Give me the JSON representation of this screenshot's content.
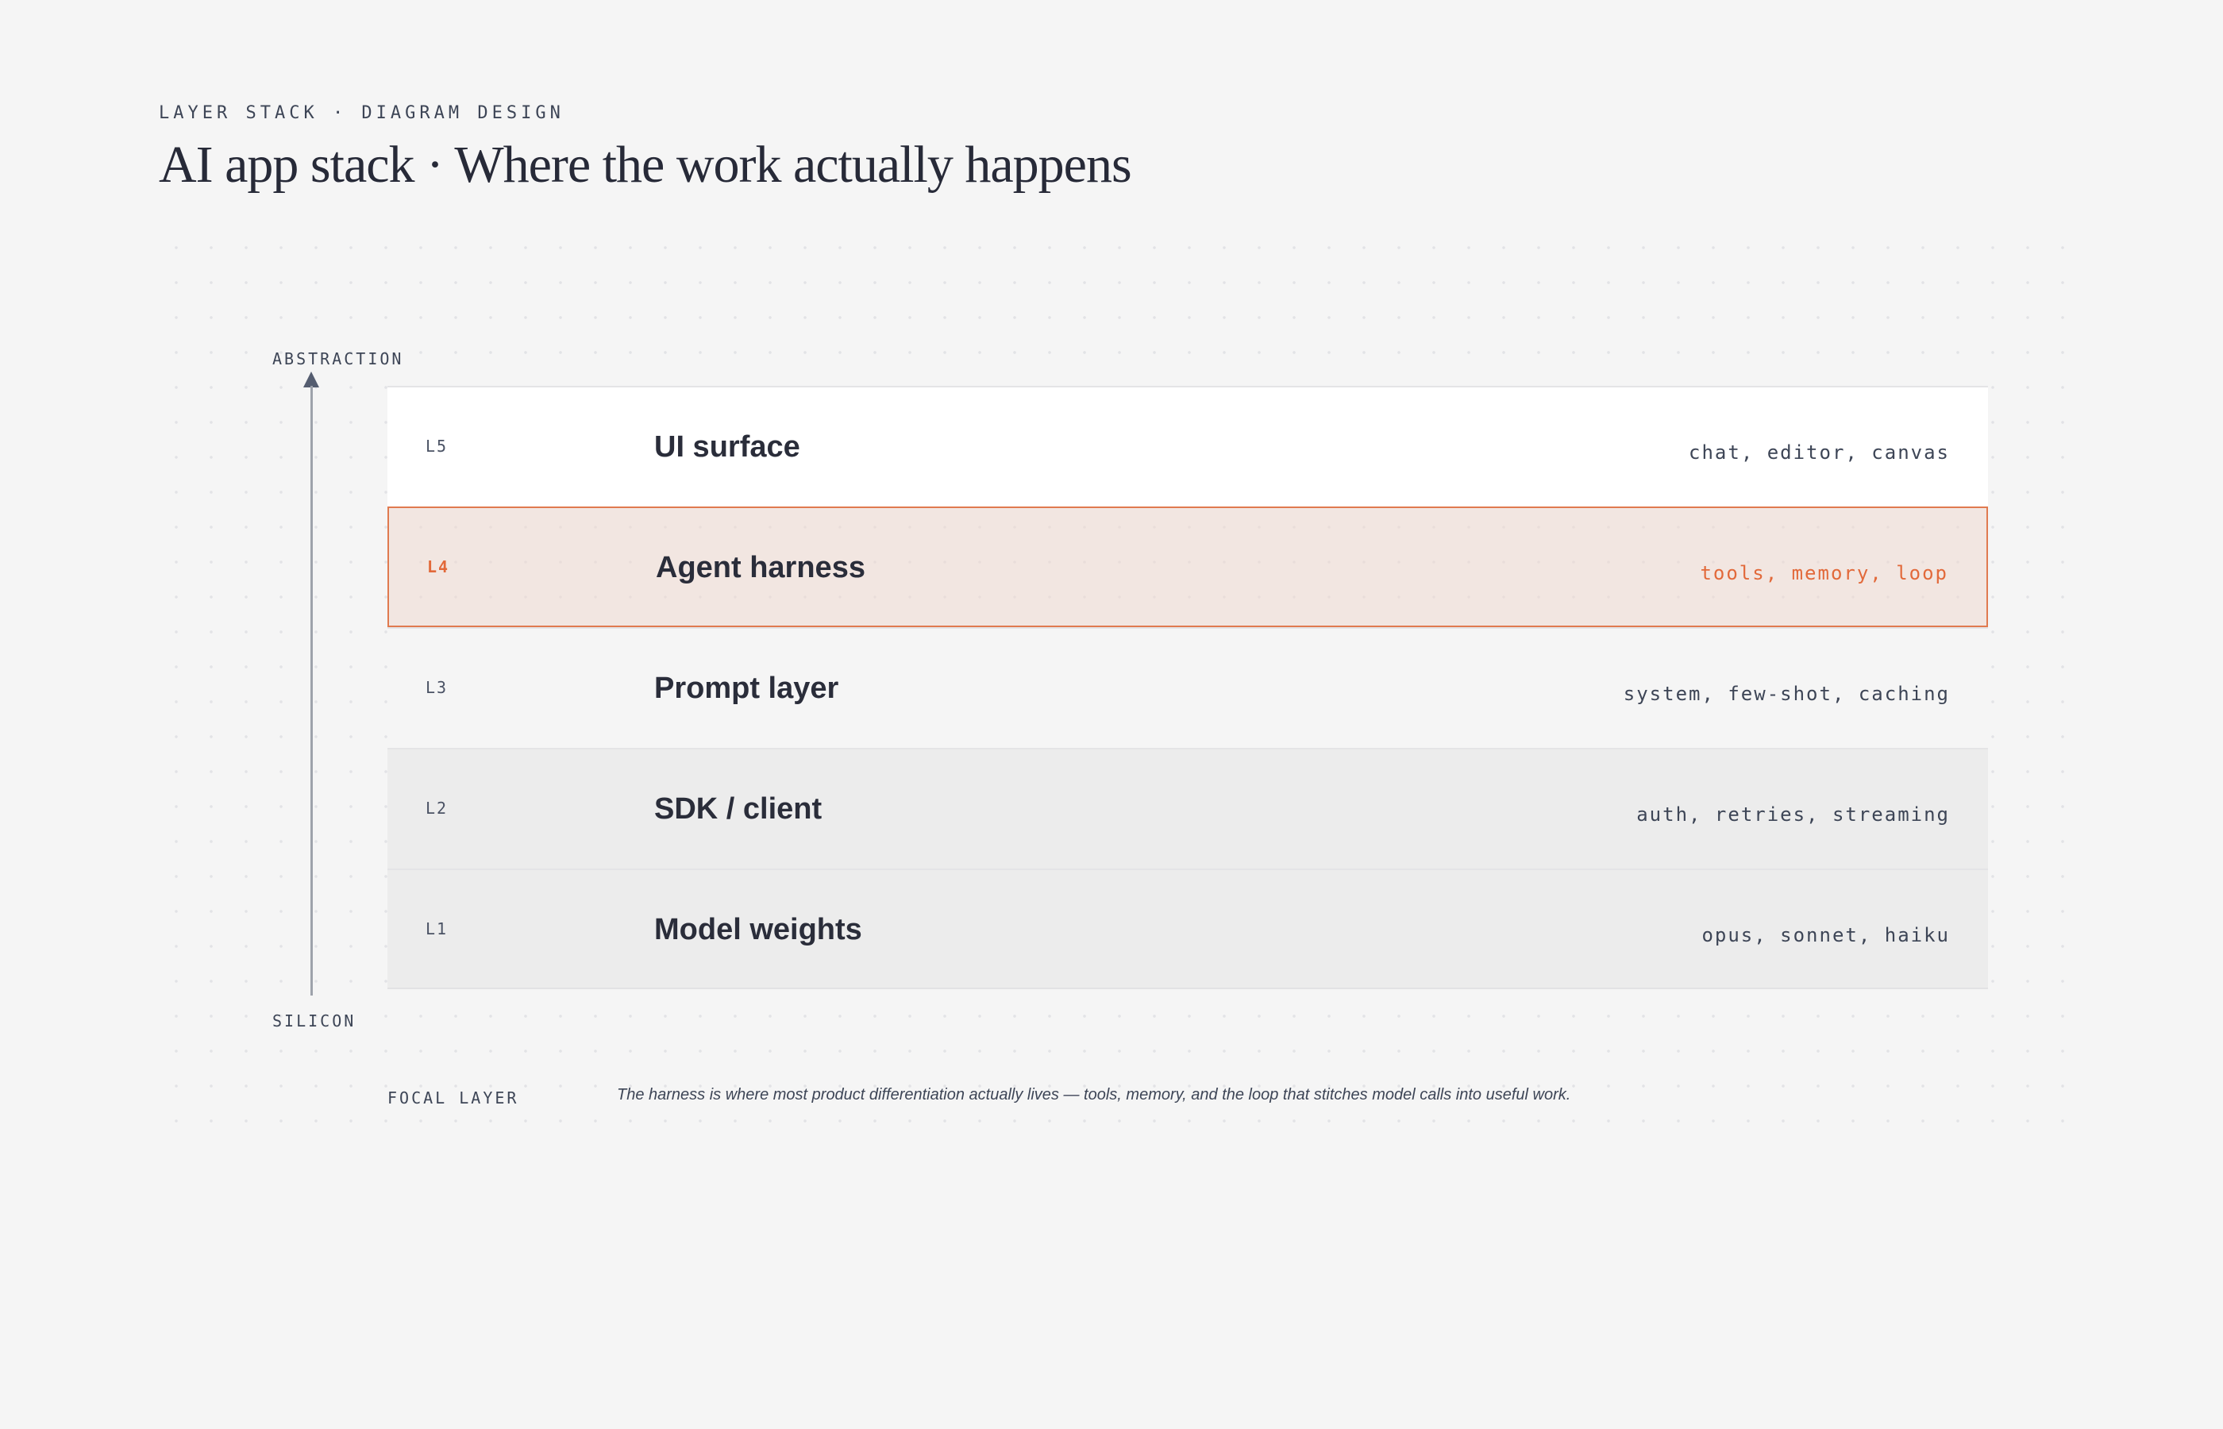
{
  "header": {
    "eyebrow": "LAYER STACK · DIAGRAM DESIGN",
    "title": "AI app stack · Where the work actually happens"
  },
  "axis": {
    "top_label": "ABSTRACTION",
    "bottom_label": "SILICON"
  },
  "layers": [
    {
      "code": "L5",
      "name": "UI surface",
      "tags": "chat, editor, canvas",
      "focal": false
    },
    {
      "code": "L4",
      "name": "Agent harness",
      "tags": "tools, memory, loop",
      "focal": true
    },
    {
      "code": "L3",
      "name": "Prompt layer",
      "tags": "system, few-shot, caching",
      "focal": false
    },
    {
      "code": "L2",
      "name": "SDK / client",
      "tags": "auth, retries, streaming",
      "focal": false
    },
    {
      "code": "L1",
      "name": "Model weights",
      "tags": "opus, sonnet, haiku",
      "focal": false
    }
  ],
  "footer": {
    "label": "FOCAL LAYER",
    "note": "The harness is where most product differentiation actually lives — tools, memory, and the loop that stitches model calls into useful work."
  },
  "colors": {
    "accent": "#e2693a",
    "focal_border": "#e07a4f",
    "focal_fill": "#f4e8e3",
    "text": "#2a2d3a",
    "muted_text": "#3d4556",
    "background": "#f5f5f5",
    "axis_arrow": "#555d70"
  },
  "icons": {
    "axis": "arrow-up-icon"
  }
}
